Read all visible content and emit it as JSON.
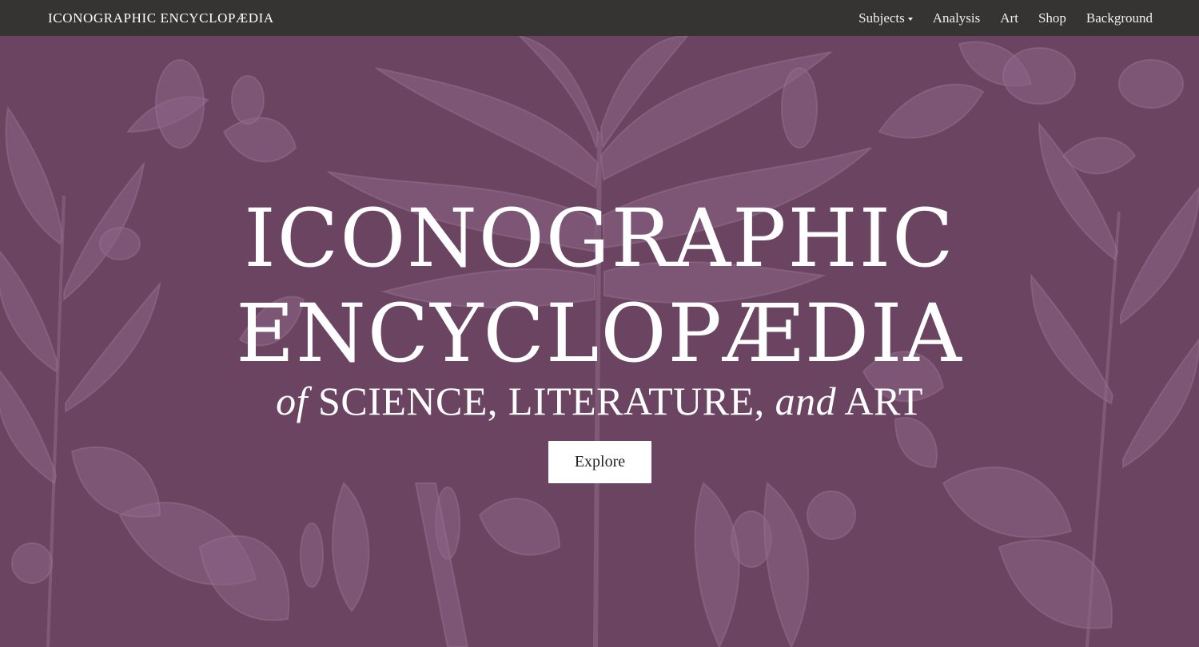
{
  "navbar": {
    "brand": "ICONOGRAPHIC ENCYCLOPÆDIA",
    "items": [
      {
        "label": "Subjects",
        "has_dropdown": true
      },
      {
        "label": "Analysis"
      },
      {
        "label": "Art"
      },
      {
        "label": "Shop"
      },
      {
        "label": "Background"
      }
    ]
  },
  "hero": {
    "title_line1": "ICONOGRAPHIC",
    "title_line2": "ENCYCLOPÆDIA",
    "subtitle_of": "of",
    "subtitle_science": "SCIENCE, LITERATURE,",
    "subtitle_and": "and",
    "subtitle_art": "ART",
    "button_label": "Explore"
  },
  "colors": {
    "navbar_bg": "#363432",
    "hero_bg": "#6b4462",
    "illustration": "#8c6585",
    "text": "#ffffff"
  }
}
